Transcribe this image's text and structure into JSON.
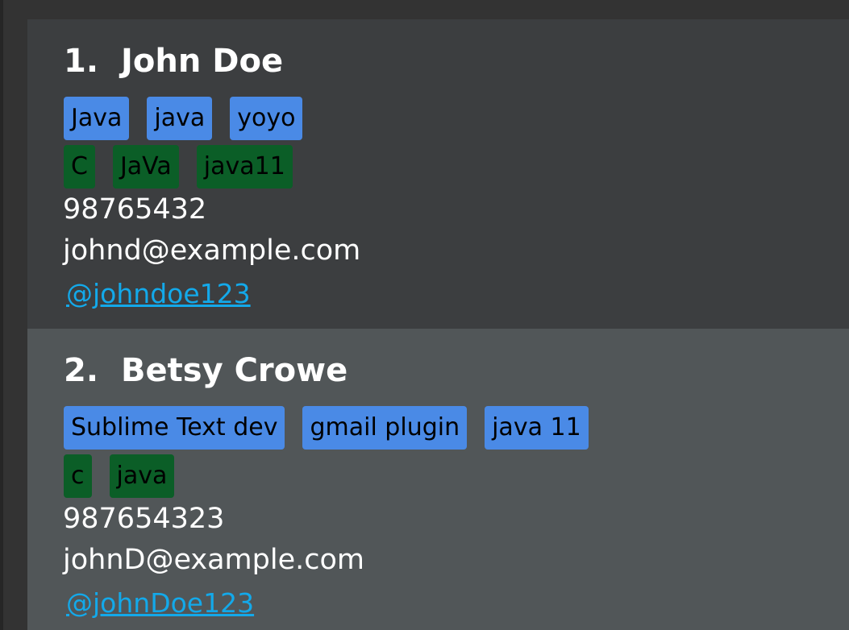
{
  "persons": [
    {
      "index": "1.",
      "name": "John Doe",
      "tags_primary": [
        "Java",
        "java",
        "yoyo"
      ],
      "tags_secondary": [
        "C",
        "JaVa",
        "java11"
      ],
      "phone": "98765432",
      "email": "johnd@example.com",
      "handle": "@johndoe123"
    },
    {
      "index": "2.",
      "name": "Betsy Crowe",
      "tags_primary": [
        "Sublime Text dev",
        "gmail plugin",
        "java 11"
      ],
      "tags_secondary": [
        "c",
        "java"
      ],
      "phone": "987654323",
      "email": "johnD@example.com",
      "handle": "@johnDoe123"
    }
  ],
  "colors": {
    "card_odd": "#3c3e40",
    "card_even": "#515658",
    "tag_primary": "#4a8ae6",
    "tag_secondary": "#0b5e27",
    "link": "#13a9ea"
  }
}
